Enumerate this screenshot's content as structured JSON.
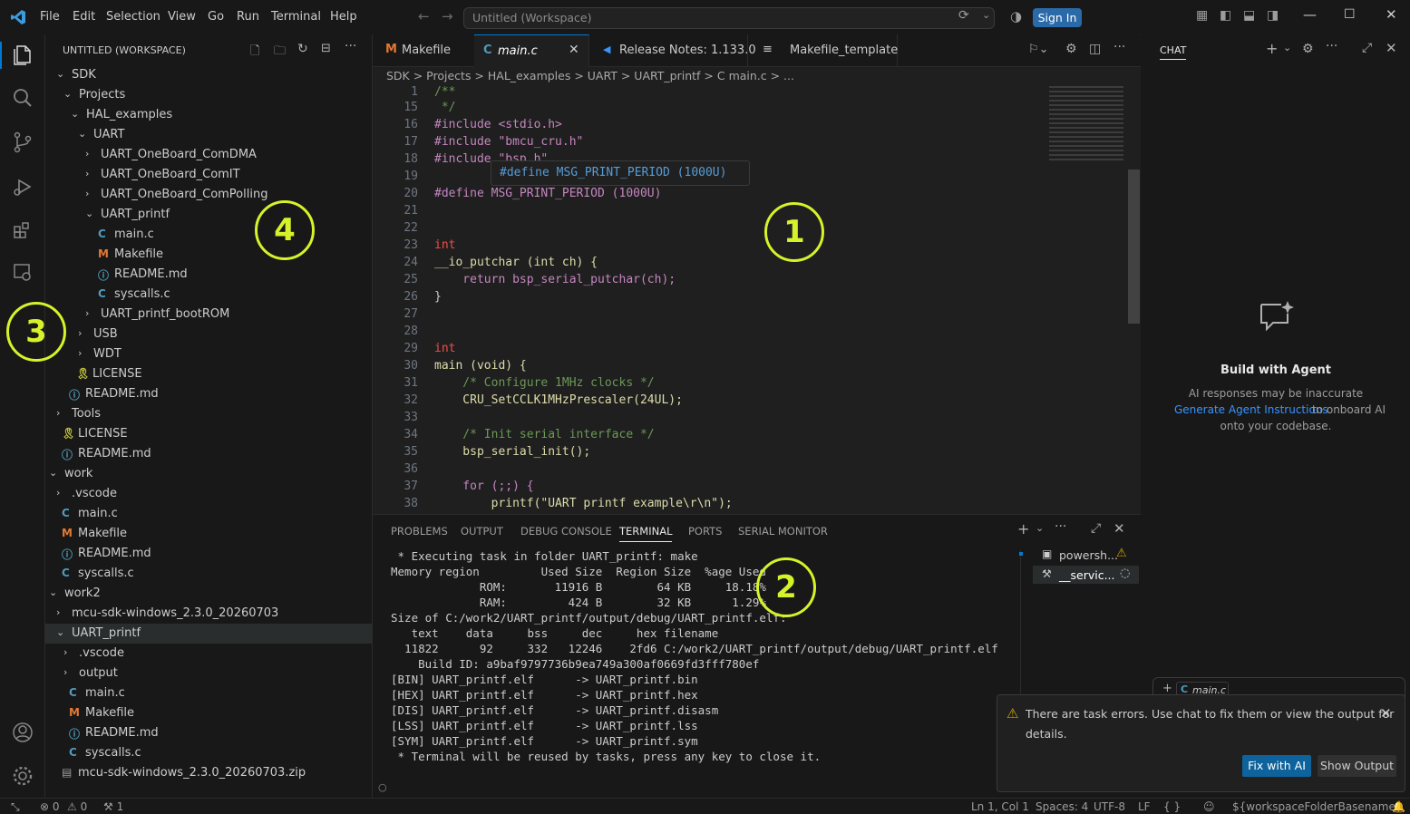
{
  "menu": [
    "File",
    "Edit",
    "Selection",
    "View",
    "Go",
    "Run",
    "Terminal",
    "Help"
  ],
  "search": {
    "text": "Untitled (Workspace)"
  },
  "signin_label": "Sign In",
  "explorer": {
    "title": "UNTITLED (WORKSPACE)",
    "items": [
      {
        "label": "SDK",
        "chev": "v",
        "icon": "",
        "color": ""
      },
      {
        "label": "Projects",
        "chev": "v",
        "icon": "",
        "color": ""
      },
      {
        "label": "HAL_examples",
        "chev": "v",
        "icon": "",
        "color": ""
      },
      {
        "label": "UART",
        "chev": "v",
        "icon": "",
        "color": ""
      },
      {
        "label": "UART_OneBoard_ComDMA",
        "chev": ">",
        "icon": "",
        "color": ""
      },
      {
        "label": "UART_OneBoard_ComIT",
        "chev": ">",
        "icon": "",
        "color": ""
      },
      {
        "label": "UART_OneBoard_ComPolling",
        "chev": ">",
        "icon": "",
        "color": ""
      },
      {
        "label": "UART_printf",
        "chev": "v",
        "icon": "",
        "color": ""
      },
      {
        "label": "main.c",
        "chev": "",
        "icon": "C",
        "color": "#519aba"
      },
      {
        "label": "Makefile",
        "chev": "",
        "icon": "M",
        "color": "#e37933"
      },
      {
        "label": "README.md",
        "chev": "",
        "icon": "ⓘ",
        "color": "#519aba"
      },
      {
        "label": "syscalls.c",
        "chev": "",
        "icon": "C",
        "color": "#519aba"
      },
      {
        "label": "UART_printf_bootROM",
        "chev": ">",
        "icon": "",
        "color": ""
      },
      {
        "label": "USB",
        "chev": ">",
        "icon": "",
        "color": ""
      },
      {
        "label": "WDT",
        "chev": ">",
        "icon": "",
        "color": ""
      },
      {
        "label": "LICENSE",
        "chev": "",
        "icon": "🎗",
        "color": "#cbcb41"
      },
      {
        "label": "README.md",
        "chev": "",
        "icon": "ⓘ",
        "color": "#519aba"
      },
      {
        "label": "Tools",
        "chev": ">",
        "icon": "",
        "color": ""
      },
      {
        "label": "LICENSE",
        "chev": "",
        "icon": "🎗",
        "color": "#cbcb41"
      },
      {
        "label": "README.md",
        "chev": "",
        "icon": "ⓘ",
        "color": "#519aba"
      },
      {
        "label": "work",
        "chev": "v",
        "icon": "",
        "color": ""
      },
      {
        "label": ".vscode",
        "chev": ">",
        "icon": "",
        "color": ""
      },
      {
        "label": "main.c",
        "chev": "",
        "icon": "C",
        "color": "#519aba"
      },
      {
        "label": "Makefile",
        "chev": "",
        "icon": "M",
        "color": "#e37933"
      },
      {
        "label": "README.md",
        "chev": "",
        "icon": "ⓘ",
        "color": "#519aba"
      },
      {
        "label": "syscalls.c",
        "chev": "",
        "icon": "C",
        "color": "#519aba"
      },
      {
        "label": "work2",
        "chev": "v",
        "icon": "",
        "color": ""
      },
      {
        "label": "mcu-sdk-windows_2.3.0_20260703",
        "chev": ">",
        "icon": "",
        "color": ""
      },
      {
        "label": "UART_printf",
        "chev": "v",
        "icon": "",
        "color": ""
      },
      {
        "label": ".vscode",
        "chev": ">",
        "icon": "",
        "color": ""
      },
      {
        "label": "output",
        "chev": ">",
        "icon": "",
        "color": ""
      },
      {
        "label": "main.c",
        "chev": "",
        "icon": "C",
        "color": "#519aba"
      },
      {
        "label": "Makefile",
        "chev": "",
        "icon": "M",
        "color": "#e37933"
      },
      {
        "label": "README.md",
        "chev": "",
        "icon": "ⓘ",
        "color": "#519aba"
      },
      {
        "label": "syscalls.c",
        "chev": "",
        "icon": "C",
        "color": "#519aba"
      },
      {
        "label": "mcu-sdk-windows_2.3.0_20260703.zip",
        "chev": "",
        "icon": "▤",
        "color": "#9d9d9d"
      }
    ]
  },
  "tabs": [
    {
      "label": "Makefile",
      "icon": "M",
      "color": "#e37933"
    },
    {
      "label": "main.c",
      "icon": "C",
      "color": "#519aba"
    },
    {
      "label": "Release Notes: 1.133.0",
      "icon": "◀",
      "color": "#3794ff"
    },
    {
      "label": "Makefile_template",
      "icon": "≡",
      "color": "#cccccc"
    }
  ],
  "breadcrumb": "SDK > Projects > HAL_examples > UART > UART_printf > C main.c > ...",
  "code": [
    {
      "n": "1",
      "t": "/**"
    },
    {
      "n": "15",
      "t": " */"
    },
    {
      "n": "16",
      "t": "#include <stdio.h>"
    },
    {
      "n": "17",
      "t": "#include \"bmcu_cru.h\""
    },
    {
      "n": "18",
      "t": "#include \"bsp.h\""
    },
    {
      "n": "19",
      "t": ""
    },
    {
      "n": "20",
      "t": "#define MSG_PRINT_PERIOD (1000U)"
    },
    {
      "n": "21",
      "t": ""
    },
    {
      "n": "22",
      "t": ""
    },
    {
      "n": "23",
      "t": "int"
    },
    {
      "n": "24",
      "t": "__io_putchar (int ch) {"
    },
    {
      "n": "25",
      "t": "    return bsp_serial_putchar(ch);"
    },
    {
      "n": "26",
      "t": "}"
    },
    {
      "n": "27",
      "t": ""
    },
    {
      "n": "28",
      "t": ""
    },
    {
      "n": "29",
      "t": "int"
    },
    {
      "n": "30",
      "t": "main (void) {"
    },
    {
      "n": "31",
      "t": "    /* Configure 1MHz clocks */"
    },
    {
      "n": "32",
      "t": "    CRU_SetCCLK1MHzPrescaler(24UL);"
    },
    {
      "n": "33",
      "t": ""
    },
    {
      "n": "34",
      "t": "    /* Init serial interface */"
    },
    {
      "n": "35",
      "t": "    bsp_serial_init();"
    },
    {
      "n": "36",
      "t": ""
    },
    {
      "n": "37",
      "t": "    for (;;) {"
    },
    {
      "n": "38",
      "t": "        printf(\"UART printf example\\r\\n\");"
    }
  ],
  "hover": "#define MSG_PRINT_PERIOD (1000U)",
  "panel_tabs": [
    "PROBLEMS",
    "OUTPUT",
    "DEBUG CONSOLE",
    "TERMINAL",
    "PORTS",
    "SERIAL MONITOR"
  ],
  "terminal": [
    " * Executing task in folder UART_printf: make",
    "Memory region         Used Size  Region Size  %age Used",
    "             ROM:       11916 B        64 KB     18.18%",
    "             RAM:         424 B        32 KB      1.29%",
    "Size of C:/work2/UART_printf/output/debug/UART_printf.elf:",
    "   text    data     bss     dec     hex filename",
    "  11822      92     332   12246    2fd6 C:/work2/UART_printf/output/debug/UART_printf.elf",
    "    Build ID: a9baf9797736b9ea749a300af0669fd3fff780ef",
    "[BIN] UART_printf.elf      -> UART_printf.bin",
    "[HEX] UART_printf.elf      -> UART_printf.hex",
    "[DIS] UART_printf.elf      -> UART_printf.disasm",
    "[LSS] UART_printf.elf      -> UART_printf.lss",
    "[SYM] UART_printf.elf      -> UART_printf.sym",
    " * Terminal will be reused by tasks, press any key to close it."
  ],
  "terminal_list": [
    "powersh...",
    "__servic..."
  ],
  "chat": {
    "tab": "CHAT",
    "heading": "Build with Agent",
    "line1": "AI responses may be inaccurate",
    "link": "Generate Agent Instructions",
    "line2": "to onboard AI",
    "line3": "onto your codebase.",
    "context_chip": "main.c"
  },
  "notification": {
    "line1": "There are task errors. Use chat to fix them or view the output for",
    "line2": "details.",
    "fix_btn": "Fix with AI",
    "show_btn": "Show Output"
  },
  "status": {
    "errors": "0",
    "warnings": "0",
    "ports": "1",
    "position": "Ln 1, Col 1",
    "spaces": "Spaces: 4",
    "encoding": "UTF-8",
    "eol": "LF",
    "braces": "{ }",
    "workspace": "${workspaceFolderBasename}"
  },
  "markers": [
    "1",
    "2",
    "3",
    "4"
  ]
}
